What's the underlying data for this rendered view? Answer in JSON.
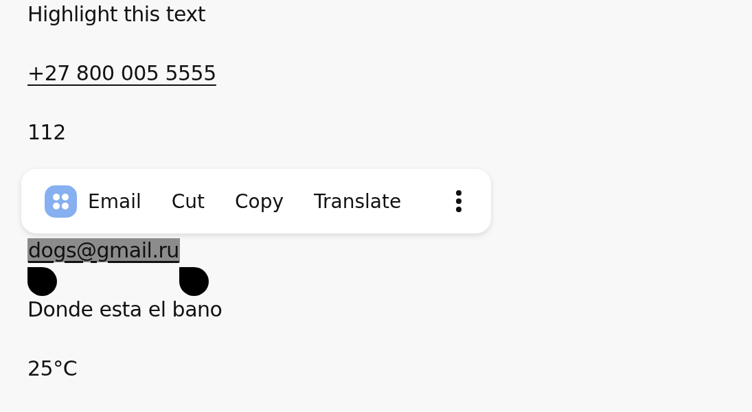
{
  "lines": [
    {
      "kind": "text",
      "text": "Highlight this text"
    },
    {
      "kind": "link",
      "text": "+27 800 005 5555"
    },
    {
      "kind": "text",
      "text": "112"
    },
    {
      "kind": "hidden"
    },
    {
      "kind": "selected",
      "text": "dogs@gmail.ru"
    },
    {
      "kind": "text",
      "text": "Donde esta el bano"
    },
    {
      "kind": "text",
      "text": "25°C"
    }
  ],
  "menu": {
    "items": [
      {
        "kind": "app",
        "label": "Email"
      },
      {
        "kind": "text",
        "label": "Cut"
      },
      {
        "kind": "text",
        "label": "Copy"
      },
      {
        "kind": "text",
        "label": "Translate"
      },
      {
        "kind": "more"
      }
    ]
  }
}
